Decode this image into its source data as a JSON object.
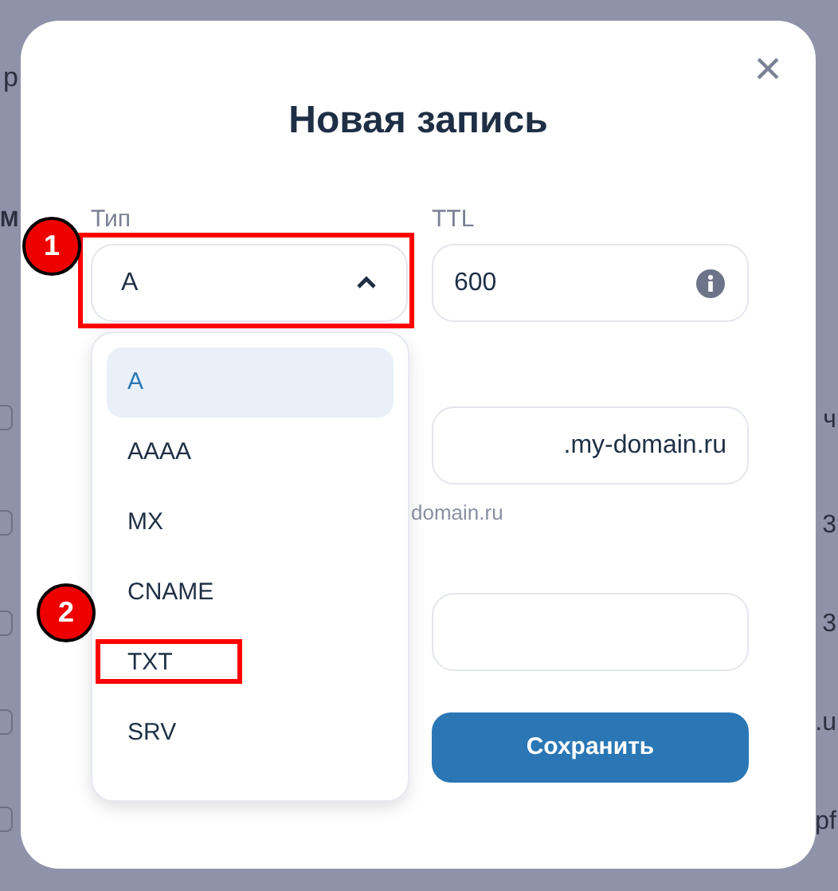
{
  "background": {
    "left_texts": [
      "р",
      "М"
    ],
    "rows": [
      {
        "checked": false,
        "text": "ч"
      },
      {
        "checked": false,
        "text": "3"
      },
      {
        "checked": false,
        "text": "3"
      },
      {
        "checked": false,
        "text": ".u"
      },
      {
        "checked": false,
        "text": "pf"
      }
    ]
  },
  "dialog": {
    "title": "Новая запись",
    "close": "×",
    "type_field": {
      "label": "Тип",
      "value": "A",
      "expanded": true
    },
    "ttl_field": {
      "label": "TTL",
      "value": "600"
    },
    "options": [
      {
        "label": "A",
        "selected": true
      },
      {
        "label": "AAAA",
        "selected": false
      },
      {
        "label": "MX",
        "selected": false
      },
      {
        "label": "CNAME",
        "selected": false
      },
      {
        "label": "TXT",
        "selected": false
      },
      {
        "label": "SRV",
        "selected": false
      }
    ],
    "name_field": {
      "suffix": ".my-domain.ru",
      "hint": "domain.ru"
    },
    "save_button": "Сохранить"
  },
  "annotations": [
    {
      "number": "1"
    },
    {
      "number": "2"
    }
  ]
}
